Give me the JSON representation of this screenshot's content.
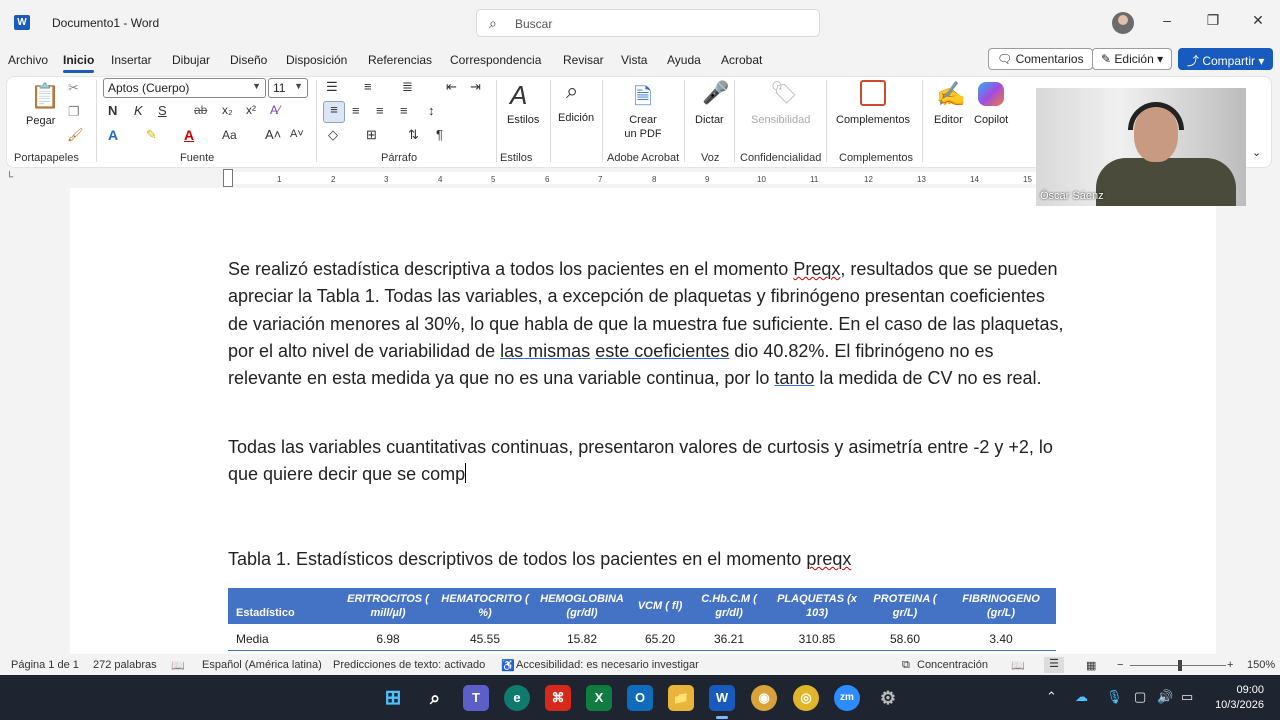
{
  "title_bar": {
    "doc_title": "Documento1 - Word",
    "search_placeholder": "Buscar",
    "logo_letter": "W"
  },
  "menu": {
    "items": [
      "Archivo",
      "Inicio",
      "Insertar",
      "Dibujar",
      "Diseño",
      "Disposición",
      "Referencias",
      "Correspondencia",
      "Revisar",
      "Vista",
      "Ayuda",
      "Acrobat"
    ],
    "active": "Inicio",
    "comments_label": "Comentarios",
    "editing_label": "Edición",
    "share_label": "Compartir"
  },
  "ribbon": {
    "paste_label": "Pegar",
    "font_name": "Aptos (Cuerpo)",
    "font_size": "11",
    "styles_label": "Estilos",
    "edition_label": "Edición",
    "create_pdf_label": "Crear un PDF",
    "dictate_label": "Dictar",
    "sensitivity_label": "Sensibilidad",
    "addins_label": "Complementos",
    "editor_label": "Editor",
    "copilot_label": "Copilot",
    "groups": {
      "clipboard": "Portapapeles",
      "font": "Fuente",
      "paragraph": "Párrafo",
      "styles": "Estilos",
      "acrobat": "Adobe Acrobat",
      "voice": "Voz",
      "confidentiality": "Confidencialidad",
      "addins": "Complementos"
    }
  },
  "ruler_numbers": [
    "1",
    "2",
    "3",
    "4",
    "5",
    "6",
    "7",
    "8",
    "9",
    "10",
    "11",
    "12",
    "13",
    "14",
    "15"
  ],
  "document": {
    "p1": {
      "a": "Se realizó estadística descriptiva a todos los pacientes en el momento ",
      "b": "Preqx",
      "c": ", resultados que se pueden apreciar la Tabla 1. Todas las variables, a excepción de plaquetas y fibrinógeno presentan coeficientes de variación menores al 30%, lo que habla de que la muestra fue suficiente. En el caso de las plaquetas, por el alto nivel de variabilidad de ",
      "d": "las mismas",
      "e": " ",
      "f": "este coeficientes",
      "g": " dio 40.82%. El fibrinógeno no es relevante en esta medida ya que no es una variable continua, por lo ",
      "h": "tanto",
      "i": " la medida de CV no es real."
    },
    "p2": "Todas las variables cuantitativas continuas, presentaron valores de curtosis y asimetría entre -2 y +2, lo que quiere decir que se comp",
    "caption_a": "Tabla 1. Estadísticos descriptivos de todos los pacientes en el momento ",
    "caption_b": "preqx",
    "table": {
      "headers": [
        "Estadístico",
        "ERITROCITOS ( mill/µl)",
        "HEMATOCRITO ( %)",
        "HEMOGLOBINA (gr/dl)",
        "VCM ( fl)",
        "C.Hb.C.M ( gr/dl)",
        "PLAQUETAS (x 103)",
        "PROTEINA ( gr/L)",
        "FIBRINOGENO (gr/L)"
      ],
      "rows": [
        [
          "Media",
          "6.98",
          "45.55",
          "15.82",
          "65.20",
          "36.21",
          "310.85",
          "58.60",
          "3.40"
        ]
      ]
    }
  },
  "webcam": {
    "name": "Óscar Sáenz"
  },
  "status_bar": {
    "page": "Página 1 de 1",
    "words": "272 palabras",
    "language": "Español (América latina)",
    "predictions": "Predicciones de texto: activado",
    "accessibility": "Accesibilidad: es necesario investigar",
    "focus": "Concentración",
    "zoom": "150%"
  },
  "taskbar": {
    "time": "09:00",
    "date": "10/3/2026"
  }
}
